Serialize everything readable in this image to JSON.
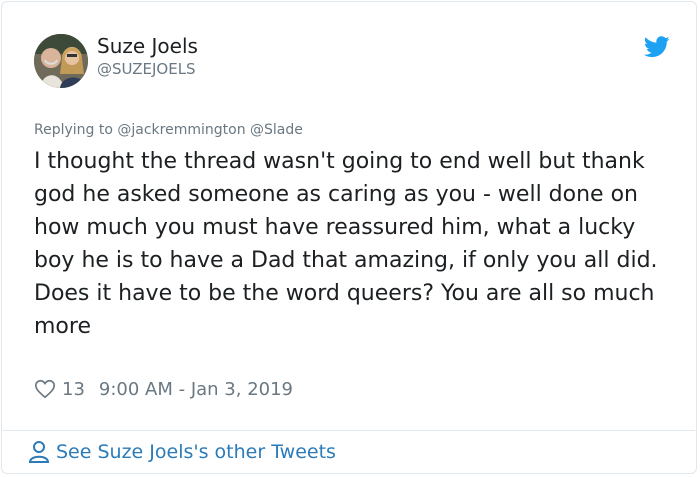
{
  "author": {
    "name": "Suze Joels",
    "handle": "@SUZEJOELS"
  },
  "icons": {
    "brand": "twitter-bird-icon",
    "like": "heart-icon",
    "profile": "person-icon"
  },
  "colors": {
    "brand": "#1da1f2",
    "link": "#2b7bb9",
    "muted": "#697882",
    "text": "#1c2022"
  },
  "reply": {
    "prefix": "Replying to",
    "mentions": [
      "@jackremmington",
      "@Slade"
    ]
  },
  "tweet": {
    "line1": "I thought the thread wasn't going to end well but thank god he asked someone as caring as you - well done on how much you must have reassured him, what a lucky boy he is to have a Dad that amazing, if only you all did.",
    "line2": "Does it have to be the word queers? You are all so much more"
  },
  "meta": {
    "likes": "13",
    "timestamp": "9:00 AM - Jan 3, 2019"
  },
  "footer": {
    "label": "See Suze Joels's other Tweets"
  }
}
